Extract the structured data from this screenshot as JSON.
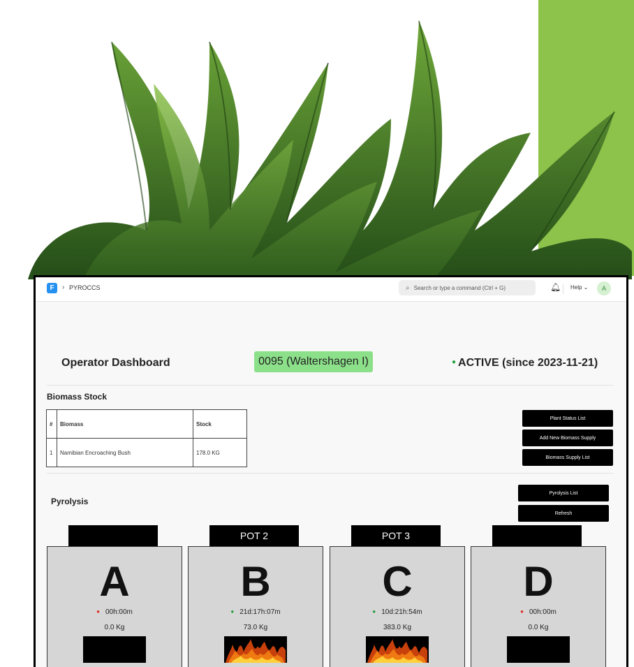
{
  "colors": {
    "accent_green": "#8dc34a",
    "badge_green": "#8ce08a",
    "status_green": "#22a33a",
    "idle_red": "#e0241c"
  },
  "navbar": {
    "logo": "F",
    "breadcrumb": "PYROCCS",
    "search_placeholder": "Search or type a command (Ctrl + G)",
    "help_label": "Help ⌄",
    "avatar_initial": "A"
  },
  "header": {
    "title": "Operator Dashboard",
    "plant": "0095 (Waltershagen I)",
    "status": "ACTIVE (since 2023-11-21)"
  },
  "biomass": {
    "title": "Biomass Stock",
    "columns": [
      "#",
      "Biomass",
      "Stock"
    ],
    "rows": [
      {
        "num": "1",
        "name": "Namibian Encroaching Bush",
        "stock": "178.0 KG"
      }
    ],
    "buttons": {
      "plant_status": "Plant Status List",
      "add_supply": "Add New Biomass Supply",
      "supply_list": "Biomass Supply List"
    }
  },
  "pyrolysis": {
    "title": "Pyrolysis",
    "buttons": {
      "list": "Pyrolysis List",
      "refresh": "Refresh"
    },
    "pots": [
      {
        "tab": "",
        "letter": "A",
        "timer": "00h:00m",
        "weight": "0.0 Kg",
        "status": "idle"
      },
      {
        "tab": "POT 2",
        "letter": "B",
        "timer": "21d:17h:07m",
        "weight": "73.0 Kg",
        "status": "burning"
      },
      {
        "tab": "POT 3",
        "letter": "C",
        "timer": "10d:21h:54m",
        "weight": "383.0 Kg",
        "status": "burning"
      },
      {
        "tab": "",
        "letter": "D",
        "timer": "00h:00m",
        "weight": "0.0 Kg",
        "status": "idle"
      }
    ]
  }
}
